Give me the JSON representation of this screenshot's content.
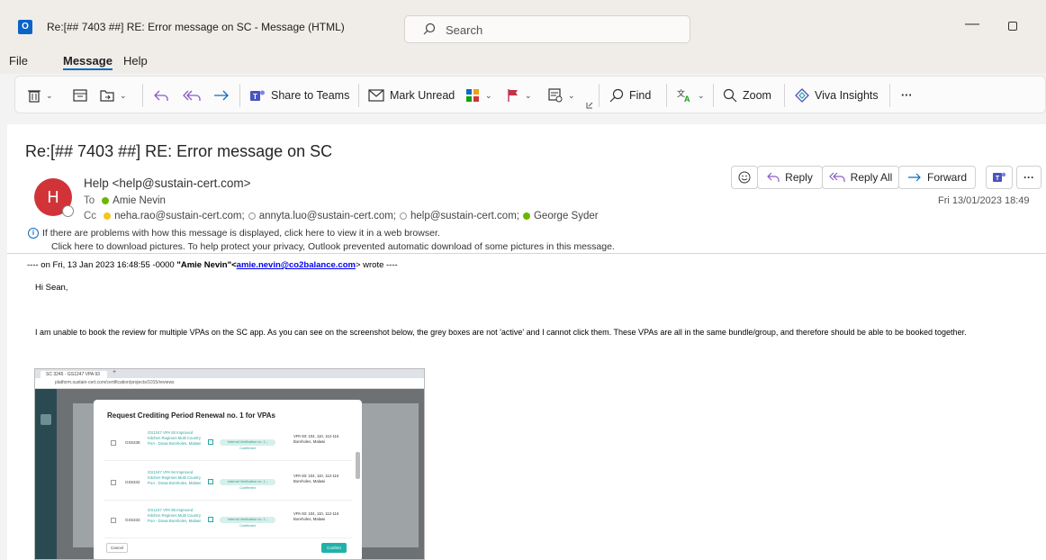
{
  "window": {
    "title": "Re:[## 7403 ##] RE: Error message on SC  -  Message (HTML)",
    "search_placeholder": "Search",
    "app_icon_letter": "O"
  },
  "menu": {
    "items": [
      "File",
      "Message",
      "Help"
    ],
    "active": "Message"
  },
  "ribbon": {
    "share_to_teams": "Share to Teams",
    "mark_unread": "Mark Unread",
    "find": "Find",
    "zoom": "Zoom",
    "viva_insights": "Viva Insights",
    "more": "···"
  },
  "message": {
    "subject": "Re:[## 7403 ##] RE: Error message on SC",
    "avatar_initial": "H",
    "from": "Help <help@sustain-cert.com>",
    "to_label": "To",
    "to": [
      "Amie Nevin"
    ],
    "cc_label": "Cc",
    "cc": [
      {
        "name": "neha.rao@sustain-cert.com;",
        "presence": "yellow"
      },
      {
        "name": "annyta.luo@sustain-cert.com;",
        "presence": "empty"
      },
      {
        "name": "help@sustain-cert.com;",
        "presence": "empty"
      },
      {
        "name": "George Syder",
        "presence": "green"
      }
    ],
    "date": "Fri 13/01/2023 18:49",
    "actions": {
      "reply": "Reply",
      "reply_all": "Reply All",
      "forward": "Forward",
      "more": "···"
    },
    "info_line1": "If there are problems with how this message is displayed, click here to view it in a web browser.",
    "info_line2": "Click here to download pictures. To help protect your privacy, Outlook prevented automatic download of some pictures in this message.",
    "quote_prefix": "---- on Fri, 13 Jan 2023 16:48:55 -0000 ",
    "quote_name": "\"Amie Nevin\"<",
    "quote_email": "amie.nevin@co2balance.com",
    "quote_suffix": "> wrote ----",
    "greeting": "Hi Sean,",
    "body": "I am unable to book the review for multiple VPAs on the SC app. As you can see on the screenshot below, the grey boxes are not 'active' and I cannot click them. These VPAs are all in the same bundle/group, and therefore should be able to be booked together."
  },
  "embedded": {
    "tab_title": "SC 3245 · GS1247 VPA 93 Impr...",
    "url": "platform.sustain-cert.com/certification/projects/1015/reviews",
    "modal_title": "Request Crediting Period Renewal no. 1 for VPAs",
    "rows": [
      {
        "id": "GS5338",
        "name": "GS1247 VPA 93 Improved Kitchen Regimes Multi Country PoA - Dowa Boreholes, Malawi",
        "status": "Internal Verification no. 1 - Confirmed",
        "location": "VPA 93: 104, 110, 112-116 Boreholes, Malawi"
      },
      {
        "id": "GS5332",
        "name": "GS1247 VPA 94 Improved Kitchen Regimes Multi Country PoA - Dowa Boreholes, Malawi",
        "status": "Internal Verification no. 1 - Confirmed",
        "location": "VPA 93: 104, 110, 112-116 Boreholes, Malawi"
      },
      {
        "id": "GS5333",
        "name": "GS1247 VPA 95 Improved Kitchen Regimes Multi Country PoA - Dowa Boreholes, Malawi",
        "status": "Internal Verification no. 1 - Confirmed",
        "location": "VPA 93: 104, 110, 112-116 Boreholes, Malawi"
      }
    ],
    "cancel": "Cancel",
    "confirm": "Confirm"
  }
}
